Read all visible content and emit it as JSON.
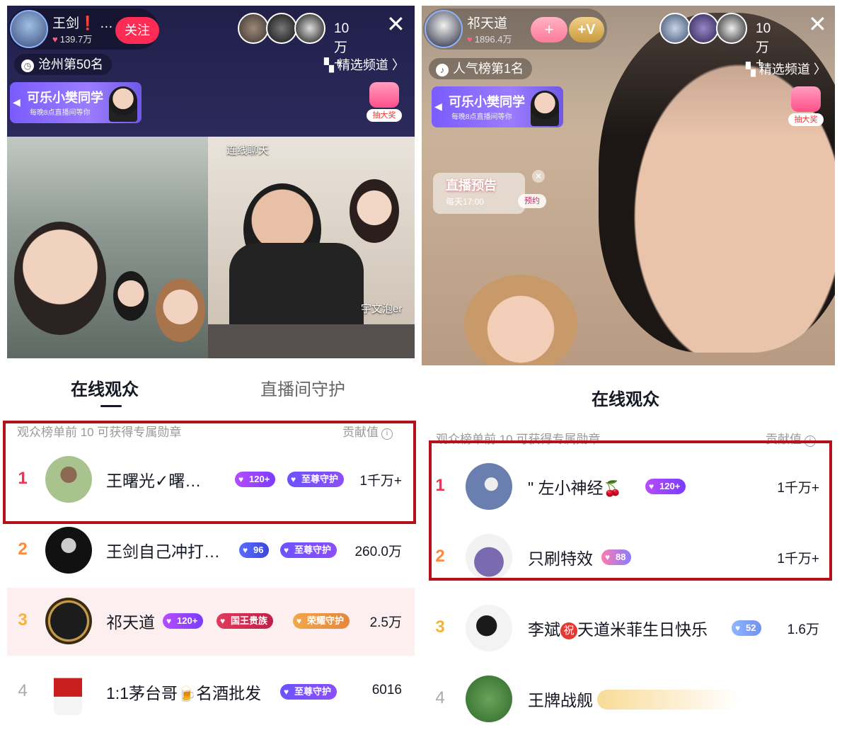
{
  "left": {
    "host": {
      "name": "王剑❗ …",
      "likes": "139.7万",
      "follow_label": "关注"
    },
    "viewer_count": "10万+",
    "rank_chip": "沧州第50名",
    "channel": "精选频道 〉",
    "promo": {
      "title": "可乐小樊同学",
      "subtitle": "每晚8点直播间等你"
    },
    "lottery_label": "抽大奖",
    "cam_label_top": "连线聊天",
    "cam_label_partner": "宇文泡er",
    "tabs": [
      {
        "label": "在线观众"
      },
      {
        "label": "直播间守护"
      }
    ],
    "hint": "观众榜单前 10 可获得专属勋章",
    "contrib_label": "贡献值",
    "rows": [
      {
        "rank": "1",
        "name": "王曙光✓曙…",
        "badges": [
          "120+",
          "至尊守护"
        ],
        "value": "1千万+"
      },
      {
        "rank": "2",
        "name": "王剑自己冲打…",
        "badges": [
          "96",
          "至尊守护"
        ],
        "value": "260.0万"
      },
      {
        "rank": "3",
        "name": "祁天道",
        "badges": [
          "120+",
          "国王贵族",
          "荣耀守护"
        ],
        "value": "2.5万"
      },
      {
        "rank": "4",
        "name": "1:1茅台哥",
        "name_tail": "名酒批发",
        "badges": [
          "至尊守护"
        ],
        "value": "6016"
      }
    ]
  },
  "right": {
    "host": {
      "name": "祁天道",
      "likes": "1896.4万"
    },
    "viewer_count": "10万+",
    "rank_chip": "人气榜第1名",
    "channel": "精选频道 〉",
    "promo": {
      "title": "可乐小樊同学",
      "subtitle": "每晚8点直播间等你"
    },
    "lottery_label": "抽大奖",
    "preview": {
      "title": "直播预告",
      "time": "每天17:00",
      "button": "预约"
    },
    "title": "在线观众",
    "hint": "观众榜单前 10 可获得专属勋章",
    "contrib_label": "贡献值",
    "rows": [
      {
        "rank": "1",
        "name": "\" 左小神经",
        "badges": [
          "120+"
        ],
        "value": "1千万+"
      },
      {
        "rank": "2",
        "name": "只刷特效",
        "badges": [
          "88"
        ],
        "value": "1千万+"
      },
      {
        "rank": "3",
        "name_pre": "李斌",
        "zhu": "祝",
        "name_post": "天道米菲生日快乐",
        "badges": [
          "52"
        ],
        "value": "1.6万"
      },
      {
        "rank": "4",
        "name": "王牌战舰"
      }
    ]
  },
  "colors": {
    "accent": "#fe2c55",
    "highlight_border": "#b3121b",
    "self_row_bg": "#fdeff0"
  },
  "icons": [
    "heart-icon",
    "close-icon",
    "location-icon",
    "grid-icon",
    "chevron-right-icon",
    "info-icon",
    "gift-icon",
    "cherry-icon",
    "beer-icon"
  ]
}
